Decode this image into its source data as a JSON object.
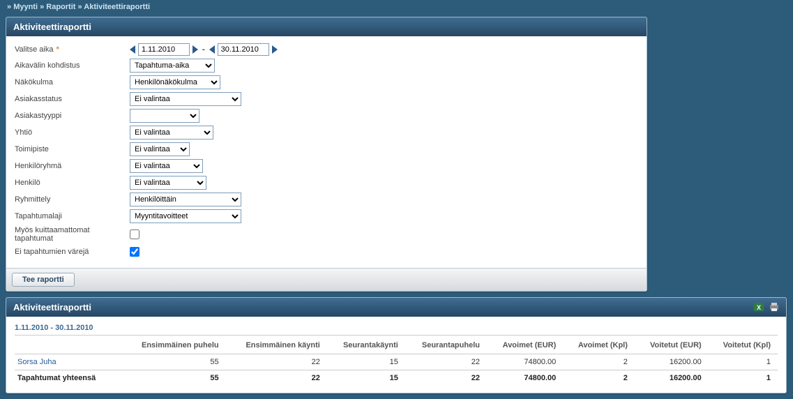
{
  "breadcrumb": {
    "a": "Myynti",
    "b": "Raportit",
    "c": "Aktiviteettiraportti",
    "sep": "»"
  },
  "panel": {
    "title": "Aktiviteettiraportti"
  },
  "form": {
    "date_label": "Valitse aika",
    "date_from": "1.11.2010",
    "date_to": "30.11.2010",
    "range_label": "Aikavälin kohdistus",
    "range_value": "Tapahtuma-aika",
    "view_label": "Näkökulma",
    "view_value": "Henkilönäkökulma",
    "custstatus_label": "Asiakasstatus",
    "custstatus_value": "Ei valintaa",
    "custtype_label": "Asiakastyyppi",
    "custtype_value": "",
    "company_label": "Yhtiö",
    "company_value": "Ei valintaa",
    "office_label": "Toimipiste",
    "office_value": "Ei valintaa",
    "group_label": "Henkilöryhmä",
    "group_value": "Ei valintaa",
    "person_label": "Henkilö",
    "person_value": "Ei valintaa",
    "grouping_label": "Ryhmittely",
    "grouping_value": "Henkilöittäin",
    "eventtype_label": "Tapahtumalaji",
    "eventtype_value": "Myyntitavoitteet",
    "unconfirmed_label": "Myös kuittaamattomat tapahtumat",
    "nocolors_label": "Ei tapahtumien värejä",
    "submit": "Tee raportti"
  },
  "results": {
    "title": "Aktiviteettiraportti",
    "daterange": "1.11.2010 - 30.11.2010",
    "columns": [
      "",
      "Ensimmäinen puhelu",
      "Ensimmäinen käynti",
      "Seurantakäynti",
      "Seurantapuhelu",
      "Avoimet (EUR)",
      "Avoimet (Kpl)",
      "Voitetut (EUR)",
      "Voitetut (Kpl)"
    ],
    "rows": [
      {
        "name": "Sorsa Juha",
        "c1": "55",
        "c2": "22",
        "c3": "15",
        "c4": "22",
        "c5": "74800.00",
        "c6": "2",
        "c7": "16200.00",
        "c8": "1"
      }
    ],
    "total": {
      "label": "Tapahtumat yhteensä",
      "c1": "55",
      "c2": "22",
      "c3": "15",
      "c4": "22",
      "c5": "74800.00",
      "c6": "2",
      "c7": "16200.00",
      "c8": "1"
    }
  }
}
